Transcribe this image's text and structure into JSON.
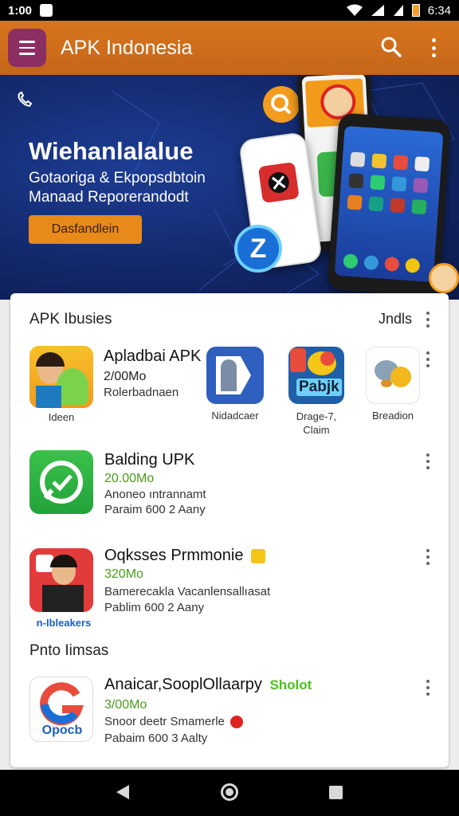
{
  "status_bar": {
    "time_left": "1:00",
    "time_right": "6:34"
  },
  "app_bar": {
    "title": "APK Indonesia",
    "search_icon": "search-icon",
    "more_icon": "more-vert-icon"
  },
  "banner": {
    "title": "Wiehanlalalue",
    "subtitle_line1": "Gotaoriga & Ekpopsdbtoin",
    "subtitle_line2": "Manaad Reporerandodt",
    "button_label": "Dasfandlein"
  },
  "section1": {
    "title": "APK Ibusies",
    "more_label": "Jndls",
    "featured": {
      "name": "Apladbai APK",
      "size": "2/00Mo",
      "line": "Rolerbadnaen",
      "label": "Ideen"
    },
    "grid": [
      {
        "label": "Nidadcaer"
      },
      {
        "label_line1": "Drage-7,",
        "label_line2": "Claim"
      },
      {
        "label": "Breadion"
      }
    ]
  },
  "apps": [
    {
      "name": "Balding UPK",
      "size": "20.00Mo",
      "line1": "Anoneo ıntrannamt",
      "line2": "Paraim 600 2 Aany"
    },
    {
      "name": "Oqksses Prmmonie",
      "size": "320Mo",
      "line1": "Bamerecakla  Vacanlensallıasat",
      "line2": "Pablim 600 2 Aany",
      "icon_caption": "n-Ibleakers"
    }
  ],
  "section2": {
    "title": "Pnto Iimsas",
    "app": {
      "name": "Anaicar,SooplOllaarpy",
      "badge": "Sholot",
      "size": "3/00Mo",
      "line1": "Snoor deetr Smamerle",
      "line2": "Pabaim 600 3 Aalty",
      "icon_text": "Opocb"
    }
  }
}
